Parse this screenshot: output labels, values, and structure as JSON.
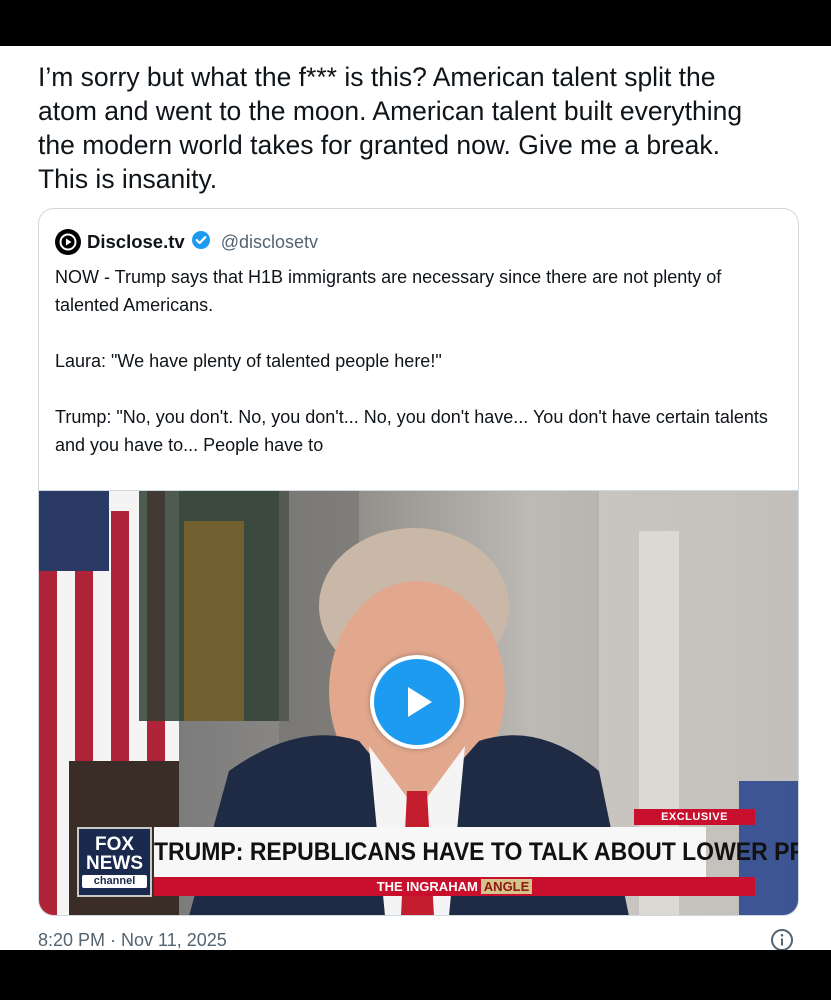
{
  "tweet": {
    "text": "I’m sorry but what the f*** is this? American talent split the\natom and went to the moon. American talent built everything\nthe modern world takes for granted now. Give me a break.\nThis is insanity.",
    "timestamp": "8:20 PM · Nov 11, 2025"
  },
  "quoted_tweet": {
    "display_name": "Disclose.tv",
    "handle": "@disclosetv",
    "verified_badge_color": "#1d9bf0",
    "paragraph_1": "NOW - Trump says that H1B immigrants are necessary since there are not plenty of talented Americans.",
    "paragraph_2": "Laura: \"We have plenty of talented people here!\"",
    "paragraph_3": "Trump: \"No, you don't. No, you don't... No, you don't have... You don't have certain talents and you have to... People have to"
  },
  "video": {
    "play_icon": "play-icon",
    "network_logo_line1": "FOX",
    "network_logo_line2": "NEWS",
    "network_logo_line3": "channel",
    "exclusive_tag": "EXCLUSIVE",
    "headline": "TRUMP: REPUBLICANS HAVE TO TALK ABOUT LOWER PRICES",
    "show_name_part1": "THE INGRAHAM",
    "show_name_part2": "ANGLE"
  },
  "colors": {
    "accent": "#1d9bf0",
    "text": "#0f1419",
    "secondary_text": "#536471",
    "news_red": "#c8102e"
  }
}
